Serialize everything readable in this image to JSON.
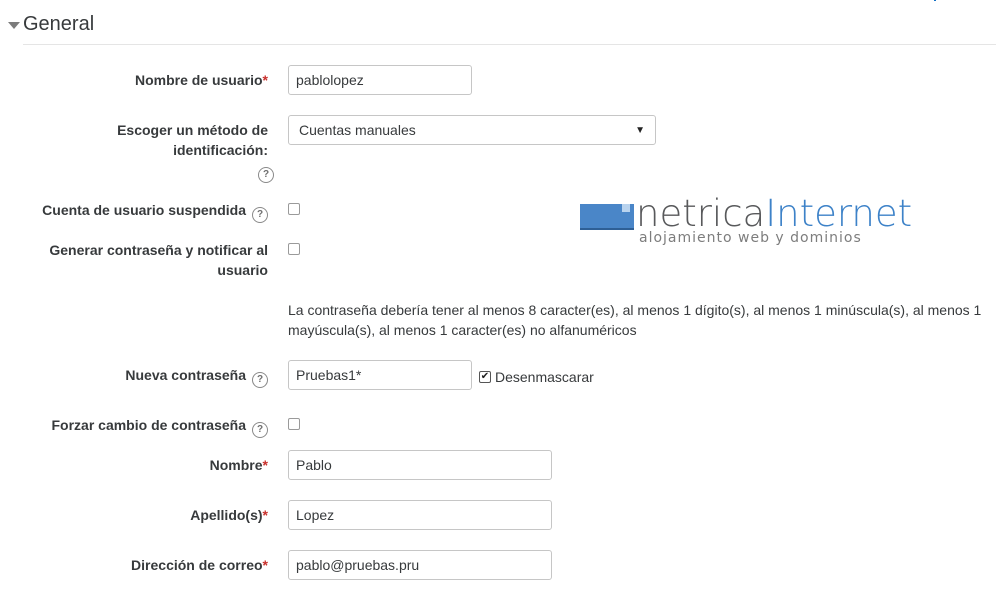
{
  "section": {
    "title": "General",
    "caret_icon": "caret-down-icon"
  },
  "fields": {
    "username": {
      "label": "Nombre de usuario",
      "value": "pablolopez",
      "required_mark": "*"
    },
    "auth": {
      "label_line1": "Escoger un método de",
      "label_line2": "identificación:",
      "selected": "Cuentas manuales",
      "help_icon": "question-circle-icon"
    },
    "suspended": {
      "label": "Cuenta de usuario suspendida",
      "checked": false,
      "help_icon": "question-circle-icon"
    },
    "generate_password": {
      "label_line1": "Generar contraseña y notificar al",
      "label_line2": "usuario",
      "checked": false
    },
    "password_policy": "La contraseña debería tener al menos 8 caracter(es), al menos 1 dígito(s), al menos 1 minúscula(s), al menos 1 mayúscula(s), al menos 1 caracter(es) no alfanuméricos",
    "new_password": {
      "label": "Nueva contraseña",
      "value": "Pruebas1*",
      "unmask_label": "Desenmascarar",
      "unmask_checked": true,
      "help_icon": "question-circle-icon"
    },
    "force_change": {
      "label": "Forzar cambio de contraseña",
      "checked": false,
      "help_icon": "question-circle-icon"
    },
    "firstname": {
      "label": "Nombre",
      "value": "Pablo",
      "required_mark": "*"
    },
    "lastname": {
      "label": "Apellido(s)",
      "value": "Lopez",
      "required_mark": "*"
    },
    "email": {
      "label": "Dirección de correo",
      "value": "pablo@pruebas.pru",
      "required_mark": "*"
    }
  },
  "logo": {
    "brand_part1": "netrica",
    "brand_part2": "Internet",
    "tagline": "alojamiento web y dominios"
  },
  "colors": {
    "required": "#c9302c",
    "brand_blue": "#3d82c8",
    "brand_gray": "#58595b",
    "link_blue": "#0f6fc5"
  }
}
